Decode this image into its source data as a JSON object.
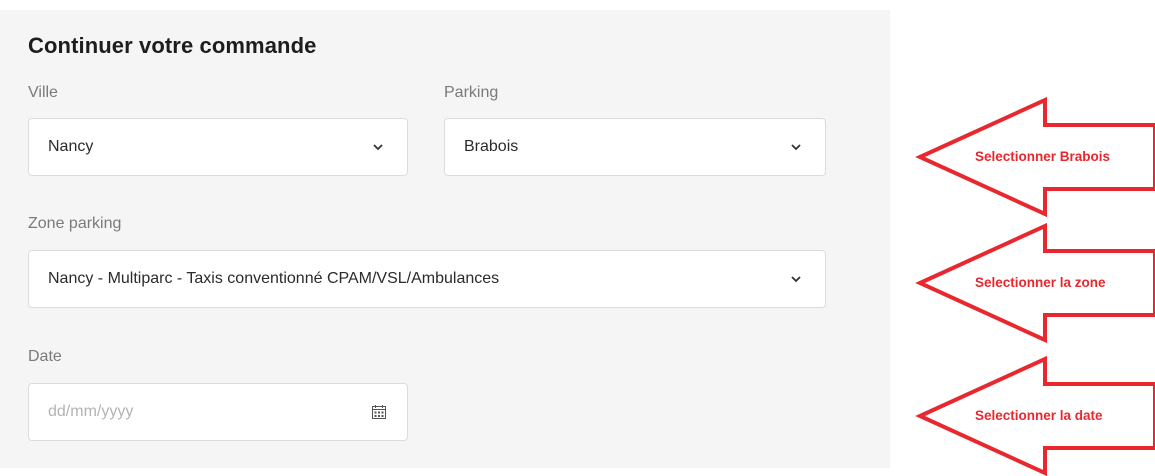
{
  "form": {
    "title": "Continuer votre commande",
    "ville": {
      "label": "Ville",
      "value": "Nancy"
    },
    "parking": {
      "label": "Parking",
      "value": "Brabois"
    },
    "zone": {
      "label": "Zone parking",
      "value": "Nancy - Multiparc - Taxis conventionné CPAM/VSL/Ambulances"
    },
    "date": {
      "label": "Date",
      "placeholder": "dd/mm/yyyy"
    }
  },
  "annotations": {
    "brabois": "Selectionner Brabois",
    "zone": "Selectionner la zone",
    "date": "Selectionner la date",
    "color": "#e8282e"
  },
  "icons": {
    "dropdown": "chevron-down-icon",
    "calendar": "calendar-icon"
  }
}
